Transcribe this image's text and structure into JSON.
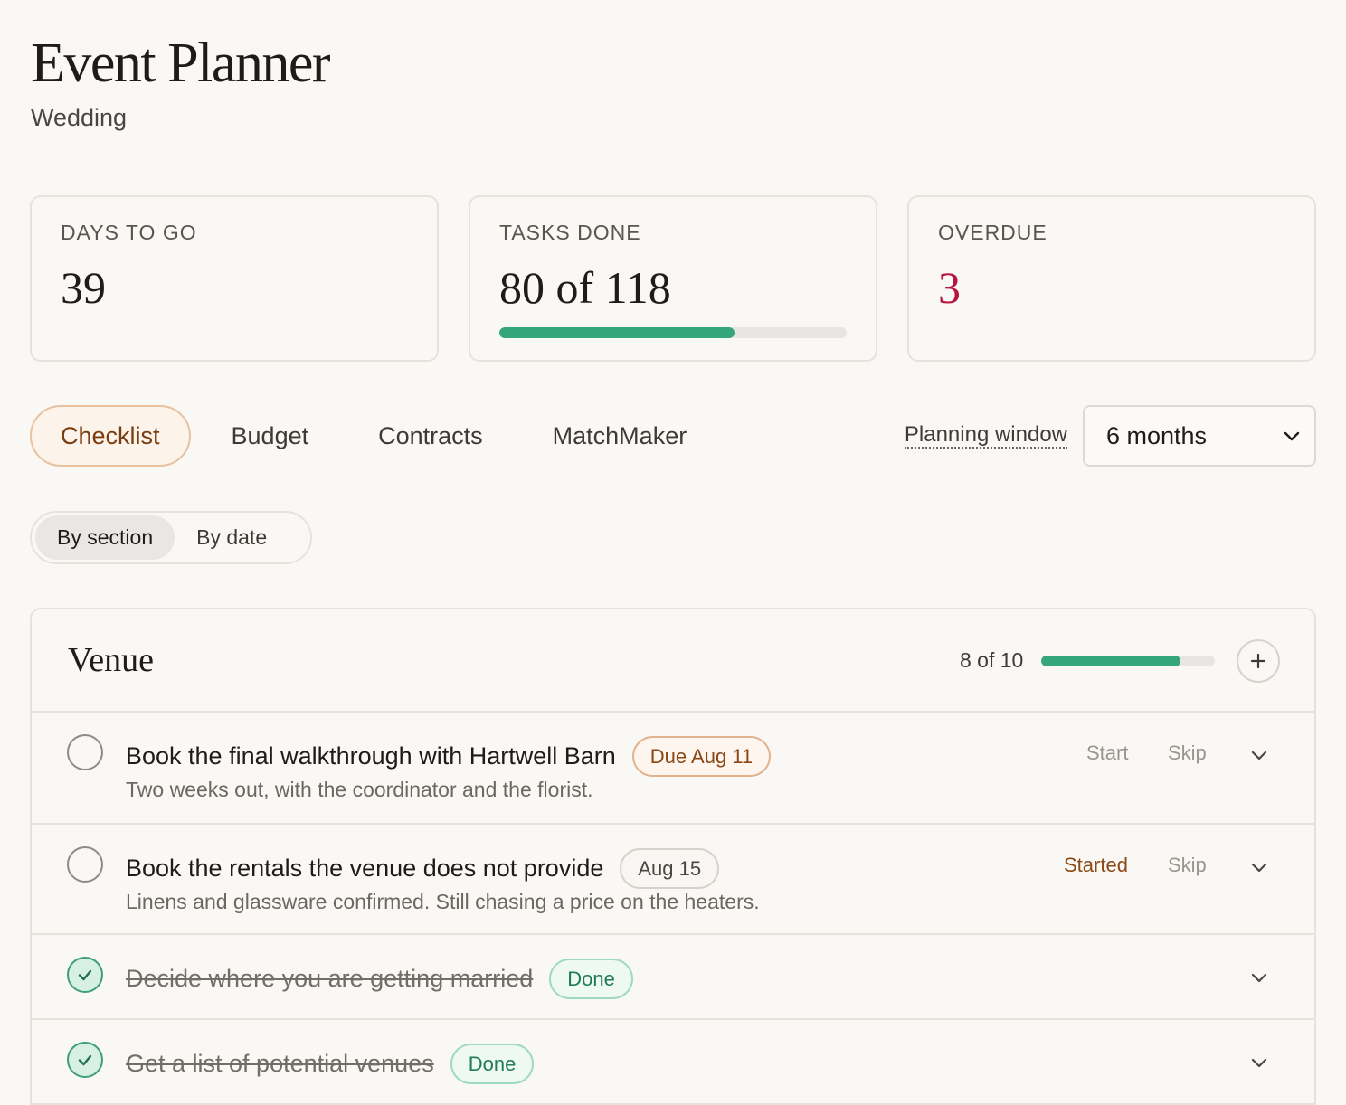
{
  "header": {
    "title": "Event Planner",
    "subtitle": "Wedding"
  },
  "stats": [
    {
      "label": "DAYS TO GO",
      "value": "39"
    },
    {
      "label": "TASKS DONE",
      "value": "80 of 118",
      "progress": 0.678
    },
    {
      "label": "OVERDUE",
      "value": "3"
    }
  ],
  "tabs": [
    "Checklist",
    "Budget",
    "Contracts",
    "MatchMaker"
  ],
  "active_tab": "Checklist",
  "planning_window": {
    "label": "Planning window",
    "selected": "6 months"
  },
  "view_toggle": {
    "options": [
      "By section",
      "By date"
    ],
    "active": "By section"
  },
  "section": {
    "title": "Venue",
    "count": "8 of 10",
    "progress": 0.8
  },
  "tasks": [
    {
      "title": "Book the final walkthrough with Hartwell Barn",
      "badge": "Due Aug 11",
      "desc": "Two weeks out, with the coordinator and the florist.",
      "action": "Start",
      "skip": "Skip",
      "done": false
    },
    {
      "title": "Book the rentals the venue does not provide",
      "badge": "Aug 15",
      "desc": "Linens and glassware confirmed. Still chasing a price on the heaters.",
      "action": "Started",
      "skip": "Skip",
      "done": false
    },
    {
      "title": "Decide where you are getting married",
      "badge": "Done",
      "done": true
    },
    {
      "title": "Get a list of potential venues",
      "badge": "Done",
      "done": true
    }
  ],
  "colors": {
    "accent": "#35a57e",
    "overdue": "#b5173f",
    "tab_active_border": "#e8c19f"
  },
  "icons": {
    "add": "plus-icon",
    "expand": "chevron-down-icon",
    "check": "check-icon",
    "select": "chevron-down-icon"
  }
}
